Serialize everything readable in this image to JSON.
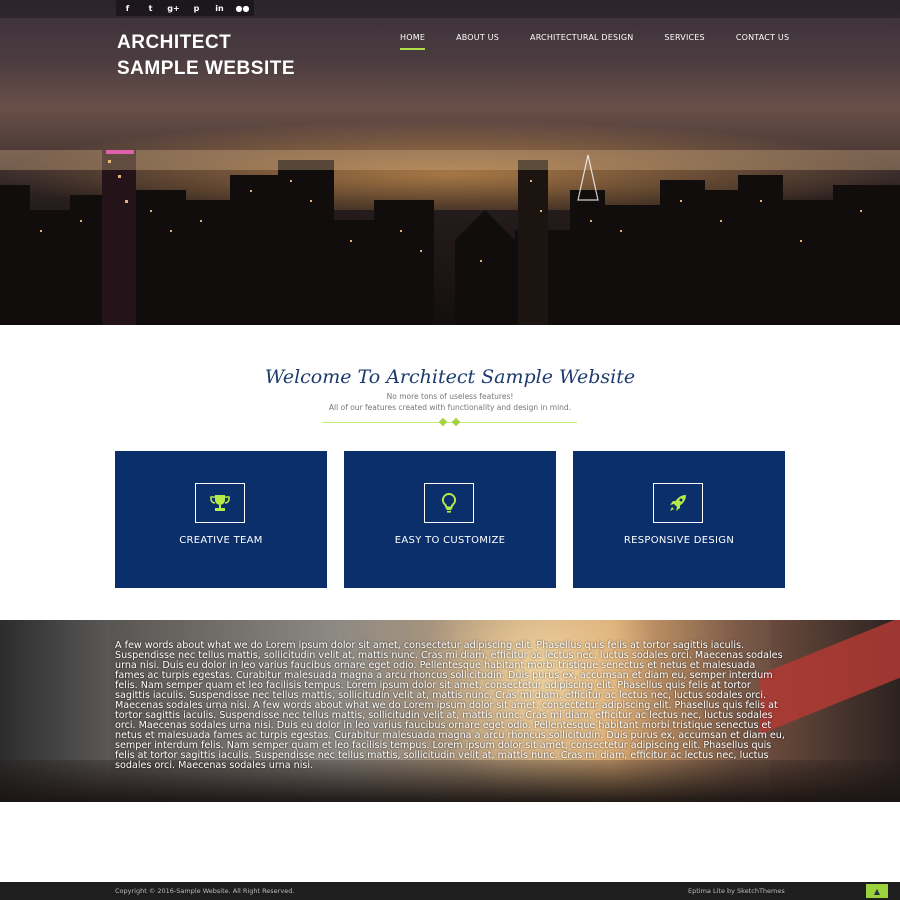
{
  "social": [
    {
      "icon": "facebook-icon",
      "glyph": "f"
    },
    {
      "icon": "twitter-icon",
      "glyph": "t"
    },
    {
      "icon": "google-plus-icon",
      "glyph": "g+"
    },
    {
      "icon": "pinterest-icon",
      "glyph": "p"
    },
    {
      "icon": "linkedin-icon",
      "glyph": "in"
    },
    {
      "icon": "flickr-icon",
      "glyph": "●●"
    }
  ],
  "logo": {
    "line1": "ARCHITECT",
    "line2": "SAMPLE WEBSITE"
  },
  "nav": [
    {
      "label": "HOME",
      "active": true
    },
    {
      "label": "ABOUT US",
      "active": false
    },
    {
      "label": "ARCHITECTURAL DESIGN",
      "active": false
    },
    {
      "label": "SERVICES",
      "active": false
    },
    {
      "label": "CONTACT US",
      "active": false
    }
  ],
  "welcome": {
    "title": "Welcome To Architect Sample Website",
    "line1": "No more tons of useless features!",
    "line2": "All of our features created with functionality and design in mind."
  },
  "features": [
    {
      "icon": "trophy-icon",
      "label": "CREATIVE TEAM"
    },
    {
      "icon": "lightbulb-icon",
      "label": "EASY TO CUSTOMIZE"
    },
    {
      "icon": "rocket-icon",
      "label": "RESPONSIVE DESIGN"
    }
  ],
  "about": {
    "text": "A few words about what we do Lorem ipsum dolor sit amet, consectetur adipiscing elit. Phasellus quis felis at tortor sagittis iaculis. Suspendisse nec tellus mattis, sollicitudin velit at, mattis nunc. Cras mi diam, efficitur ac lectus nec, luctus sodales orci. Maecenas sodales urna nisi. Duis eu dolor in leo varius faucibus ornare eget odio. Pellentesque habitant morbi tristique senectus et netus et malesuada fames ac turpis egestas. Curabitur malesuada magna a arcu rhoncus sollicitudin. Duis purus ex, accumsan et diam eu, semper interdum felis. Nam semper quam et leo facilisis tempus. Lorem ipsum dolor sit amet, consectetur adipiscing elit. Phasellus quis felis at tortor sagittis iaculis. Suspendisse nec tellus mattis, sollicitudin velit at, mattis nunc. Cras mi diam, efficitur ac lectus nec, luctus sodales orci. Maecenas sodales urna nisi. A few words about what we do Lorem ipsum dolor sit amet, consectetur adipiscing elit. Phasellus quis felis at tortor sagittis iaculis. Suspendisse nec tellus mattis, sollicitudin velit at, mattis nunc. Cras mi diam, efficitur ac lectus nec, luctus sodales orci. Maecenas sodales urna nisi. Duis eu dolor in leo varius faucibus ornare eget odio. Pellentesque habitant morbi tristique senectus et netus et malesuada fames ac turpis egestas. Curabitur malesuada magna a arcu rhoncus sollicitudin. Duis purus ex, accumsan et diam eu, semper interdum felis. Nam semper quam et leo facilisis tempus. Lorem ipsum dolor sit amet, consectetur adipiscing elit. Phasellus quis felis at tortor sagittis iaculis. Suspendisse nec tellus mattis, sollicitudin velit at, mattis nunc. Cras mi diam, efficitur ac lectus nec, luctus sodales orci. Maecenas sodales urna nisi."
  },
  "footer": {
    "copyright": "Copyright © 2016-Sample Website. All Right Reserved.",
    "credit": "Eptima Lite by SketchThemes",
    "totop_glyph": "▲"
  },
  "colors": {
    "accent": "#9cd23c",
    "card": "#0b2f6a",
    "title": "#1d3a6e"
  }
}
